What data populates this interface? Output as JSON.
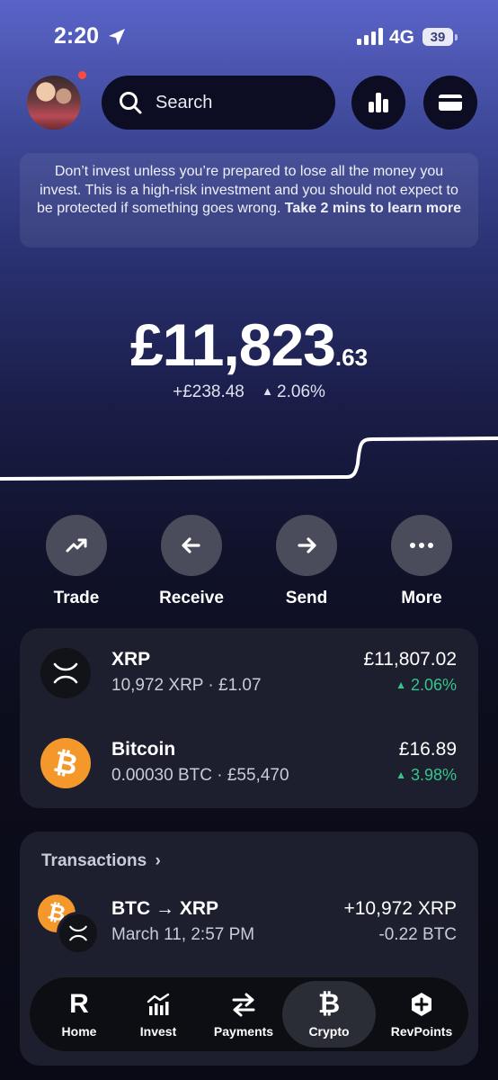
{
  "status_bar": {
    "time": "2:20",
    "network": "4G",
    "battery": "39"
  },
  "header": {
    "search_label": "Search"
  },
  "warning": {
    "text": "Don’t invest unless you’re prepared to lose all the money you invest. This is a high-risk investment and you should not expect to be protected if something goes wrong.",
    "link": "Take 2 mins to learn more"
  },
  "balance": {
    "main": "£11,823",
    "cents": ".63",
    "change_amount": "+£238.48",
    "change_percent": "2.06%"
  },
  "actions": {
    "trade": "Trade",
    "receive": "Receive",
    "send": "Send",
    "more": "More"
  },
  "assets": [
    {
      "name": "XRP",
      "sub": "10,972 XRP · £1.07",
      "value": "£11,807.02",
      "change": "2.06%",
      "icon": "xrp-icon"
    },
    {
      "name": "Bitcoin",
      "sub": "0.00030 BTC · £55,470",
      "value": "£16.89",
      "change": "3.98%",
      "icon": "bitcoin-icon"
    }
  ],
  "transactions": {
    "header": "Transactions",
    "items": [
      {
        "title": "BTC → XRP",
        "date": "March 11, 2:57 PM",
        "amount": "+10,972 XRP",
        "sub": "-0.22 BTC"
      }
    ]
  },
  "tabs": [
    {
      "label": "Home",
      "icon": "revolut-r-icon"
    },
    {
      "label": "Invest",
      "icon": "invest-chart-icon"
    },
    {
      "label": "Payments",
      "icon": "transfer-arrows-icon"
    },
    {
      "label": "Crypto",
      "icon": "bitcoin-icon"
    },
    {
      "label": "RevPoints",
      "icon": "revpoints-icon"
    }
  ],
  "colors": {
    "positive": "#35c58b",
    "bitcoin": "#f4982b",
    "alert_dot": "#ff4b3e"
  }
}
